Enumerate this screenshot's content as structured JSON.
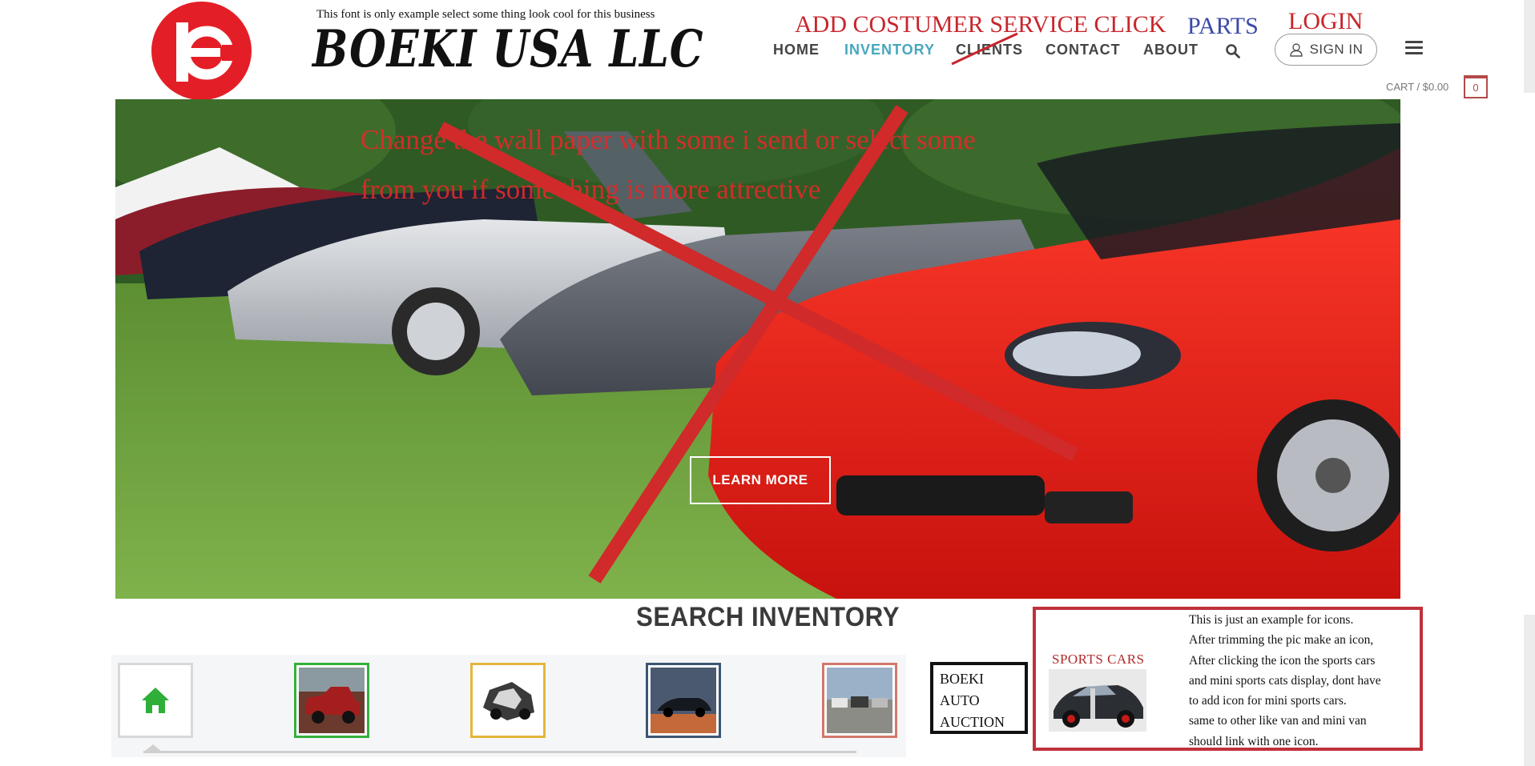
{
  "header": {
    "font_note": "This font is only example select some thing look cool for this business",
    "brand": "BOEKI USA LLC",
    "annotations": {
      "customer_service": "ADD COSTUMER SERVICE CLICK",
      "parts": "PARTS",
      "login": "LOGIN"
    },
    "nav": [
      {
        "label": "HOME",
        "active": false
      },
      {
        "label": "INVENTORY",
        "active": true
      },
      {
        "label": "CLIENTS",
        "active": false
      },
      {
        "label": "CONTACT",
        "active": false
      },
      {
        "label": "ABOUT",
        "active": false
      }
    ],
    "signin_label": "SIGN IN",
    "cart_label": "CART / $0.00",
    "cart_count": "0"
  },
  "hero": {
    "note_line1": "Change the wall paper with some i send or select some",
    "note_line2": "from you if some thing is more attrective",
    "button_label": "LEARN MORE"
  },
  "inventory": {
    "title": "SEARCH INVENTORY",
    "auction": [
      "BOEKI",
      "AUTO",
      "AUCTION"
    ],
    "sports_label": "SPORTS CARS",
    "icon_note_lines": [
      "This is just an example for icons.",
      "After trimming the pic make an icon,",
      "After clicking the icon the sports cars",
      "and mini sports cats display, dont have",
      "to add icon for mini sports cars.",
      "same to other like van and mini van",
      "should link with one icon."
    ]
  },
  "colors": {
    "logo_red": "#e41e26",
    "nav_active": "#46a7bd",
    "annotation_red": "#c8262c",
    "annotation_blue": "#3a4aa8",
    "home_icon": "#2fae38"
  },
  "icons": [
    "boeki-logo",
    "search-icon",
    "user-icon",
    "menu-icon",
    "home-icon"
  ]
}
